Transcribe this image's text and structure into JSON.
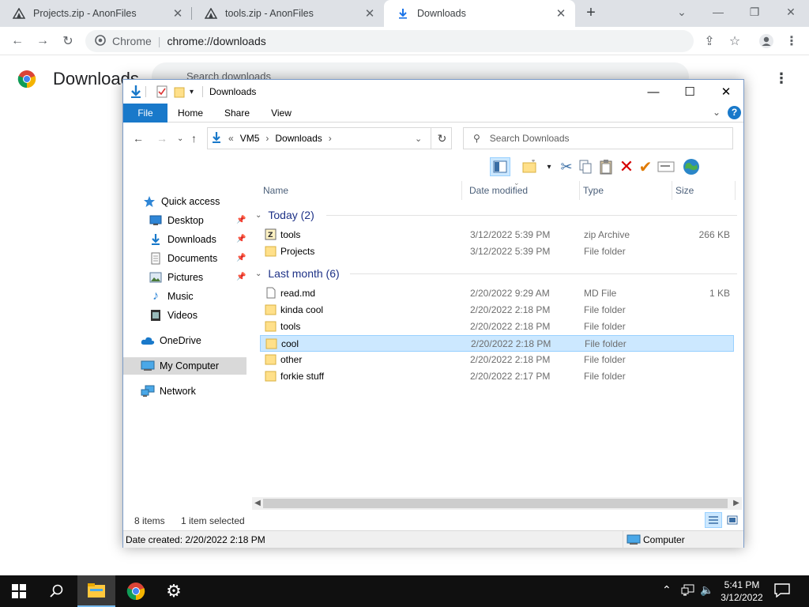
{
  "chrome": {
    "tabs": [
      {
        "title": "Projects.zip - AnonFiles",
        "active": false
      },
      {
        "title": "tools.zip - AnonFiles",
        "active": false
      },
      {
        "title": "Downloads",
        "active": true
      }
    ],
    "new_tab_symbol": "+",
    "omnibox": {
      "label": "Chrome",
      "url": "chrome://downloads"
    },
    "page_title": "Downloads",
    "search_placeholder": "Search downloads"
  },
  "explorer": {
    "title": "Downloads",
    "ribbon_tabs": [
      "File",
      "Home",
      "Share",
      "View"
    ],
    "address": {
      "prefix": "«",
      "parts": [
        "VM5",
        "Downloads"
      ]
    },
    "search_placeholder": "Search Downloads",
    "nav_pane": [
      {
        "label": "Quick access",
        "icon": "star-icon",
        "pinned": false
      },
      {
        "label": "Desktop",
        "icon": "desktop-icon",
        "pinned": true
      },
      {
        "label": "Downloads",
        "icon": "download-icon",
        "pinned": true
      },
      {
        "label": "Documents",
        "icon": "document-icon",
        "pinned": true
      },
      {
        "label": "Pictures",
        "icon": "pictures-icon",
        "pinned": true
      },
      {
        "label": "Music",
        "icon": "music-icon",
        "pinned": false
      },
      {
        "label": "Videos",
        "icon": "videos-icon",
        "pinned": false
      },
      {
        "label": "OneDrive",
        "icon": "cloud-icon",
        "pinned": false
      },
      {
        "label": "My Computer",
        "icon": "computer-icon",
        "pinned": false,
        "selected": true
      },
      {
        "label": "Network",
        "icon": "network-icon",
        "pinned": false
      }
    ],
    "columns": [
      "Name",
      "Date modified",
      "Type",
      "Size"
    ],
    "groups": [
      {
        "label": "Today (2)",
        "items": [
          {
            "name": "tools",
            "date": "3/12/2022 5:39 PM",
            "type": "zip Archive",
            "size": "266 KB",
            "icon": "zip-icon"
          },
          {
            "name": "Projects",
            "date": "3/12/2022 5:39 PM",
            "type": "File folder",
            "size": "",
            "icon": "folder-icon"
          }
        ]
      },
      {
        "label": "Last month (6)",
        "items": [
          {
            "name": "read.md",
            "date": "2/20/2022 9:29 AM",
            "type": "MD File",
            "size": "1 KB",
            "icon": "file-icon"
          },
          {
            "name": "kinda cool",
            "date": "2/20/2022 2:18 PM",
            "type": "File folder",
            "size": "",
            "icon": "folder-icon"
          },
          {
            "name": "tools",
            "date": "2/20/2022 2:18 PM",
            "type": "File folder",
            "size": "",
            "icon": "folder-icon"
          },
          {
            "name": "cool",
            "date": "2/20/2022 2:18 PM",
            "type": "File folder",
            "size": "",
            "icon": "folder-icon",
            "selected": true
          },
          {
            "name": "other",
            "date": "2/20/2022 2:18 PM",
            "type": "File folder",
            "size": "",
            "icon": "folder-icon"
          },
          {
            "name": "forkie stuff",
            "date": "2/20/2022 2:17 PM",
            "type": "File folder",
            "size": "",
            "icon": "folder-icon"
          }
        ]
      }
    ],
    "status": {
      "items": "8 items",
      "selected": "1 item selected"
    },
    "details": {
      "left": "Date created: 2/20/2022 2:18 PM",
      "right": "Computer"
    }
  },
  "taskbar": {
    "time": "5:41 PM",
    "date": "3/12/2022"
  },
  "colors": {
    "chrome_tabbar": "#dee1e6",
    "file_tab": "#1979ca",
    "selection": "#cce8ff",
    "taskbar": "#101010"
  }
}
